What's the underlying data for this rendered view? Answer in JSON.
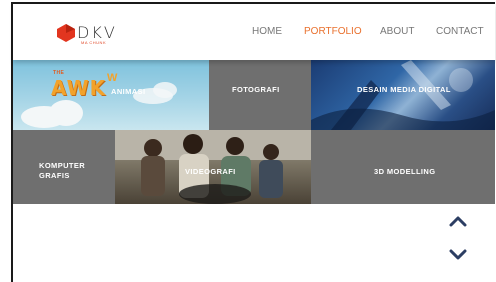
{
  "header": {
    "logo": {
      "text": "DKV",
      "subtitle": "MA CHUNK"
    },
    "nav": [
      {
        "label": "HOME",
        "active": false
      },
      {
        "label": "PORTFOLIO",
        "active": true
      },
      {
        "label": "ABOUT",
        "active": false
      },
      {
        "label": "CONTACT",
        "active": false
      }
    ]
  },
  "portfolio": {
    "animasi": {
      "label": "ANIMASI",
      "banner": "AWK",
      "banner_small": "THE",
      "banner_sup": "W"
    },
    "fotografi": {
      "label": "FOTOGRAFI"
    },
    "desain": {
      "label": "DESAIN MEDIA DIGITAL"
    },
    "komputer": {
      "label_line1": "KOMPUTER",
      "label_line2": "GRAFIS"
    },
    "videografi": {
      "label": "VIDEOGRAFI"
    },
    "modelling": {
      "label": "3D MODELLING"
    }
  },
  "scroll": {
    "up_icon": "chevron-up-icon",
    "down_icon": "chevron-down-icon"
  },
  "colors": {
    "accent": "#e9702d",
    "tile_grey": "#6f6f6f",
    "logo_red": "#e2351f"
  }
}
